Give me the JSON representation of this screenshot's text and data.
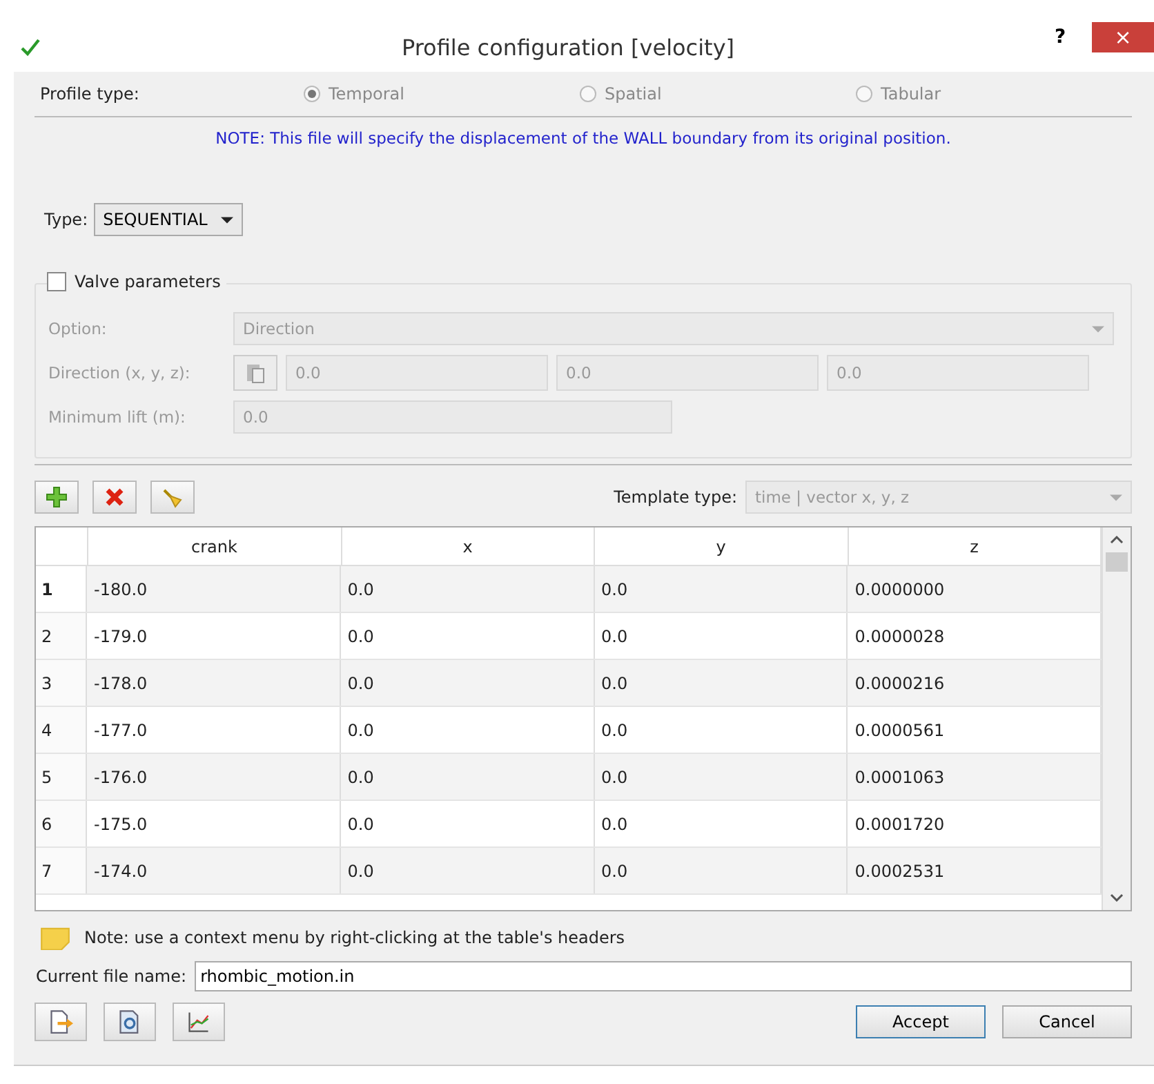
{
  "window": {
    "title": "Profile configuration [velocity]",
    "help": "?",
    "close": "×"
  },
  "profile_type": {
    "label": "Profile type:",
    "options": [
      {
        "label": "Temporal",
        "selected": true
      },
      {
        "label": "Spatial",
        "selected": false
      },
      {
        "label": "Tabular",
        "selected": false
      }
    ]
  },
  "note": "NOTE: This file will specify the displacement of the WALL boundary from its original position.",
  "type": {
    "label": "Type:",
    "value": "SEQUENTIAL"
  },
  "valve": {
    "label": "Valve parameters",
    "checked": false,
    "option_label": "Option:",
    "option_value": "Direction",
    "direction_label": "Direction (x, y, z):",
    "direction": [
      "0.0",
      "0.0",
      "0.0"
    ],
    "lift_label": "Minimum lift (m):",
    "lift": "0.0"
  },
  "template": {
    "label": "Template type:",
    "value": "time | vector x, y, z"
  },
  "table": {
    "columns": [
      "crank",
      "x",
      "y",
      "z"
    ],
    "rows": [
      {
        "index": "1",
        "selected": true,
        "cells": [
          "-180.0",
          "0.0",
          "0.0",
          "0.0000000"
        ]
      },
      {
        "index": "2",
        "selected": false,
        "cells": [
          "-179.0",
          "0.0",
          "0.0",
          "0.0000028"
        ]
      },
      {
        "index": "3",
        "selected": false,
        "cells": [
          "-178.0",
          "0.0",
          "0.0",
          "0.0000216"
        ]
      },
      {
        "index": "4",
        "selected": false,
        "cells": [
          "-177.0",
          "0.0",
          "0.0",
          "0.0000561"
        ]
      },
      {
        "index": "5",
        "selected": false,
        "cells": [
          "-176.0",
          "0.0",
          "0.0",
          "0.0001063"
        ]
      },
      {
        "index": "6",
        "selected": false,
        "cells": [
          "-175.0",
          "0.0",
          "0.0",
          "0.0001720"
        ]
      },
      {
        "index": "7",
        "selected": false,
        "cells": [
          "-174.0",
          "0.0",
          "0.0",
          "0.0002531"
        ]
      }
    ]
  },
  "hint": "Note: use a context menu by right-clicking at the table's headers",
  "file": {
    "label": "Current file name:",
    "value": "rhombic_motion.in"
  },
  "buttons": [
    "Accept",
    "Cancel"
  ]
}
